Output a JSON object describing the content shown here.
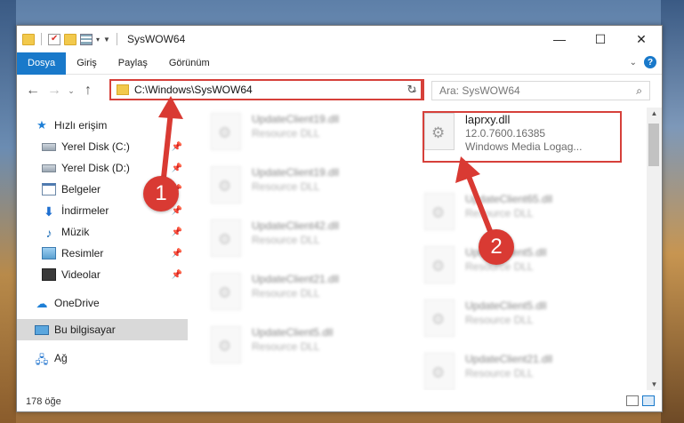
{
  "window": {
    "title": "SysWOW64",
    "caption": {
      "minimize": "—",
      "maximize": "☐",
      "close": "✕"
    }
  },
  "ribbon": {
    "tabs": [
      "Dosya",
      "Giriş",
      "Paylaş",
      "Görünüm"
    ],
    "expand_icon": "chevron-down-icon",
    "help_label": "?"
  },
  "nav": {
    "back": "←",
    "forward": "→",
    "recent": "⌄",
    "up": "↑",
    "address": "C:\\Windows\\SysWOW64",
    "refresh": "↻",
    "search_placeholder": "Ara: SysWOW64"
  },
  "sidebar": {
    "items": [
      {
        "label": "Hızlı erişim",
        "icon": "star-icon",
        "pinned": false
      },
      {
        "label": "Yerel Disk (C:)",
        "icon": "disk-icon",
        "pinned": true
      },
      {
        "label": "Yerel Disk (D:)",
        "icon": "disk-icon",
        "pinned": true
      },
      {
        "label": "Belgeler",
        "icon": "documents-icon",
        "pinned": true
      },
      {
        "label": "İndirmeler",
        "icon": "downloads-icon",
        "pinned": true
      },
      {
        "label": "Müzik",
        "icon": "music-icon",
        "pinned": true
      },
      {
        "label": "Resimler",
        "icon": "pictures-icon",
        "pinned": true
      },
      {
        "label": "Videolar",
        "icon": "videos-icon",
        "pinned": true
      },
      {
        "label": "OneDrive",
        "icon": "cloud-icon",
        "pinned": false
      },
      {
        "label": "Bu bilgisayar",
        "icon": "computer-icon",
        "pinned": false,
        "selected": true
      },
      {
        "label": "Ağ",
        "icon": "network-icon",
        "pinned": false
      }
    ]
  },
  "files": {
    "left_column": [
      {
        "name": "UpdateClient19.dll",
        "type": "Resource DLL"
      },
      {
        "name": "UpdateClient19.dll",
        "type": "Resource DLL"
      },
      {
        "name": "UpdateClient42.dll",
        "type": "Resource DLL"
      },
      {
        "name": "UpdateClient21.dll",
        "type": "Resource DLL"
      },
      {
        "name": "UpdateClient5.dll",
        "type": "Resource DLL"
      }
    ],
    "right_column": [
      {
        "name": "laprxy.dll",
        "version": "12.0.7600.16385",
        "type": "Windows Media Logag...",
        "highlighted": true
      },
      {
        "name": "UpdateClient65.dll",
        "type": "Resource DLL"
      },
      {
        "name": "UpdateClient5.dll",
        "type": "Resource DLL"
      },
      {
        "name": "UpdateClient5.dll",
        "type": "Resource DLL"
      },
      {
        "name": "UpdateClient21.dll",
        "type": "Resource DLL"
      }
    ]
  },
  "annotations": {
    "badge1": "1",
    "badge2": "2",
    "color": "#d93a33"
  },
  "status": {
    "count": "178 öğe"
  }
}
